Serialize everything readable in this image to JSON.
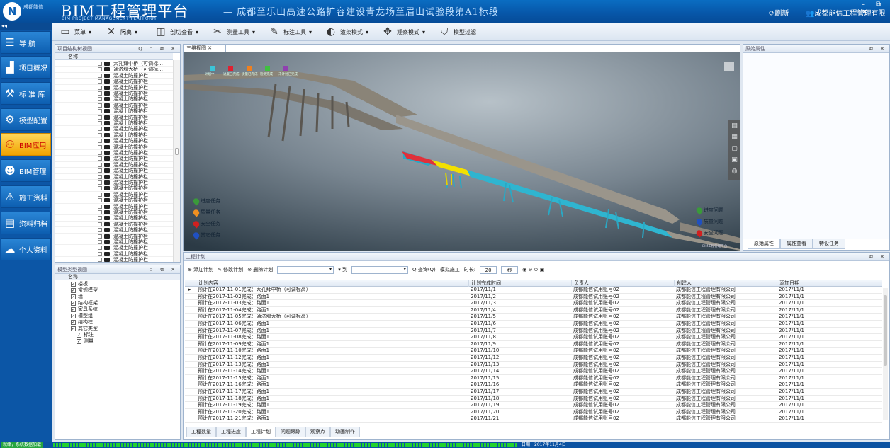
{
  "brand": "成都能信",
  "app": {
    "name": "BIM工程管理平台",
    "subtitle": "BIM PROJECT MANAGEMENT PLATFORM"
  },
  "project_title": "— 成都至乐山高速公路扩容建设青龙场至眉山试验段第A1标段",
  "header": {
    "refresh": "刷新",
    "company": "成都能信工程管理有限",
    "window_controls": "– ⧉ ✕"
  },
  "nav": {
    "collapse": "◂◂",
    "items": [
      {
        "label": "导 航",
        "icon": "list-icon"
      },
      {
        "label": "项目概况",
        "icon": "chart-icon"
      },
      {
        "label": "标 准 库",
        "icon": "tools-icon"
      },
      {
        "label": "模型配置",
        "icon": "gears-icon"
      },
      {
        "label": "BIM应用",
        "icon": "people-icon"
      },
      {
        "label": "BIM管理",
        "icon": "person-icon"
      },
      {
        "label": "施工资料",
        "icon": "warning-icon"
      },
      {
        "label": "资料归档",
        "icon": "archive-icon"
      },
      {
        "label": "个人资料",
        "icon": "cloud-user-icon"
      }
    ]
  },
  "toolbar": [
    {
      "label": "菜单",
      "icon": "▭",
      "arrow": "▾"
    },
    {
      "label": "隔离",
      "icon": "✕",
      "arrow": "▾"
    },
    {
      "label": "剖切查看",
      "icon": "◫",
      "arrow": "▾"
    },
    {
      "label": "测量工具",
      "icon": "✂",
      "arrow": "▾"
    },
    {
      "label": "标注工具",
      "icon": "✎",
      "arrow": "▾"
    },
    {
      "label": "渲染模式",
      "icon": "◐",
      "arrow": "▾"
    },
    {
      "label": "观察模式",
      "icon": "✥",
      "arrow": "▾"
    },
    {
      "label": "模型过滤",
      "icon": "⛉",
      "arrow": ""
    }
  ],
  "tree1": {
    "title": "项目结构树视图",
    "controls": "Q ▫ ⧉ ✕",
    "column": "名称",
    "rows": [
      "大孔拜中桥（可调标…",
      "通济堰大桥（可调标…",
      "混凝土防撞护栏",
      "混凝土防撞护栏",
      "混凝土防撞护栏",
      "混凝土防撞护栏",
      "混凝土防撞护栏",
      "混凝土防撞护栏",
      "混凝土防撞护栏",
      "混凝土防撞护栏",
      "混凝土防撞护栏",
      "混凝土防撞护栏",
      "混凝土防撞护栏",
      "混凝土防撞护栏",
      "混凝土防撞护栏",
      "混凝土防撞护栏",
      "混凝土防撞护栏",
      "混凝土防撞护栏",
      "混凝土防撞护栏",
      "混凝土防撞护栏",
      "混凝土防撞护栏",
      "混凝土防撞护栏",
      "混凝土防撞护栏",
      "混凝土防撞护栏",
      "混凝土防撞护栏",
      "混凝土防撞护栏",
      "混凝土防撞护栏",
      "混凝土防撞护栏",
      "混凝土防撞护栏",
      "混凝土防撞护栏",
      "混凝土防撞护栏",
      "混凝土防撞护栏",
      "混凝土防撞护栏",
      "混凝土防撞护栏"
    ]
  },
  "tree2": {
    "title": "模型类型视图",
    "controls": "▫ ⧉ ✕",
    "column": "名称",
    "rows": [
      {
        "label": "楼板",
        "indent": 0,
        "checked": true
      },
      {
        "label": "常规模型",
        "indent": 0,
        "checked": true
      },
      {
        "label": "墙",
        "indent": 0,
        "checked": true
      },
      {
        "label": "结构框架",
        "indent": 0,
        "checked": true
      },
      {
        "label": "家具系统",
        "indent": 0,
        "checked": true
      },
      {
        "label": "模型组",
        "indent": 0,
        "checked": true
      },
      {
        "label": "结构柱",
        "indent": 0,
        "checked": true
      },
      {
        "label": "其它类型",
        "indent": 0,
        "checked": true
      },
      {
        "label": "标注",
        "indent": 1,
        "checked": true
      },
      {
        "label": "测量",
        "indent": 1,
        "checked": true
      }
    ]
  },
  "view3d": {
    "tab": "三维视图 ✕",
    "legend_top": [
      {
        "label": "计划中",
        "color": "#3cc4d8"
      },
      {
        "label": "进度已完成",
        "color": "#e02030"
      },
      {
        "label": "质量已完成",
        "color": "#f08020"
      },
      {
        "label": "检测完成",
        "color": "#40c040"
      },
      {
        "label": "未计划已完成",
        "color": "#9040b0"
      }
    ],
    "tasks_left": [
      {
        "label": "进度任务",
        "color": "#3a9a3a"
      },
      {
        "label": "质量任务",
        "color": "#f09020"
      },
      {
        "label": "安全任务",
        "color": "#d02020"
      },
      {
        "label": "其它任务",
        "color": "#2050c0"
      }
    ],
    "issues_right": [
      {
        "label": "进度问题",
        "color": "#3a9a3a"
      },
      {
        "label": "质量问题",
        "color": "#2050c0"
      },
      {
        "label": "安全问题",
        "color": "#d02020"
      }
    ],
    "watermark": "BIM工程管理平台"
  },
  "props": {
    "title": "原始属性",
    "controls": "⧉ ✕",
    "tabs": [
      "原始属性",
      "属性查看",
      "特设任务"
    ]
  },
  "plan": {
    "title": "工程计划",
    "controls": "⧉ ✕",
    "toolbar": {
      "add": "⊕ 添加计划",
      "edit": "✎ 修改计划",
      "delete": "⊗ 删除计划",
      "to": "▾ 到",
      "query": "Q 查询(Q)",
      "simulate": "模拟施工",
      "duration_label": "时长:",
      "duration_value": "20",
      "unit": "秒",
      "play_icons": "◉ ⊖ ⊙ ▣"
    },
    "columns": [
      "计划内容",
      "计划完成时间",
      "负责人",
      "创建人",
      "添加日期"
    ],
    "rows": [
      [
        "预计在2017-11-01完成：大孔拜中桥（可调标高）",
        "2017/11/1",
        "成都能信试用账号02",
        "成都能信工程管理有限公司",
        "2017/11/1"
      ],
      [
        "预计在2017-11-02完成：路面1",
        "2017/11/2",
        "成都能信试用账号02",
        "成都能信工程管理有限公司",
        "2017/11/1"
      ],
      [
        "预计在2017-11-03完成：路面1",
        "2017/11/3",
        "成都能信试用账号02",
        "成都能信工程管理有限公司",
        "2017/11/1"
      ],
      [
        "预计在2017-11-04完成：路面1",
        "2017/11/4",
        "成都能信试用账号02",
        "成都能信工程管理有限公司",
        "2017/11/1"
      ],
      [
        "预计在2017-11-05完成：通济堰大桥（可调标高）",
        "2017/11/5",
        "成都能信试用账号02",
        "成都能信工程管理有限公司",
        "2017/11/1"
      ],
      [
        "预计在2017-11-06完成：路面1",
        "2017/11/6",
        "成都能信试用账号02",
        "成都能信工程管理有限公司",
        "2017/11/1"
      ],
      [
        "预计在2017-11-07完成：路面1",
        "2017/11/7",
        "成都能信试用账号02",
        "成都能信工程管理有限公司",
        "2017/11/1"
      ],
      [
        "预计在2017-11-08完成：路面1",
        "2017/11/8",
        "成都能信试用账号02",
        "成都能信工程管理有限公司",
        "2017/11/1"
      ],
      [
        "预计在2017-11-09完成：路面1",
        "2017/11/9",
        "成都能信试用账号02",
        "成都能信工程管理有限公司",
        "2017/11/1"
      ],
      [
        "预计在2017-11-10完成：路面1",
        "2017/11/10",
        "成都能信试用账号02",
        "成都能信工程管理有限公司",
        "2017/11/1"
      ],
      [
        "预计在2017-11-12完成：路面1",
        "2017/11/12",
        "成都能信试用账号02",
        "成都能信工程管理有限公司",
        "2017/11/1"
      ],
      [
        "预计在2017-11-13完成：路面1",
        "2017/11/13",
        "成都能信试用账号02",
        "成都能信工程管理有限公司",
        "2017/11/1"
      ],
      [
        "预计在2017-11-14完成：路面1",
        "2017/11/14",
        "成都能信试用账号02",
        "成都能信工程管理有限公司",
        "2017/11/1"
      ],
      [
        "预计在2017-11-15完成：路面1",
        "2017/11/15",
        "成都能信试用账号02",
        "成都能信工程管理有限公司",
        "2017/11/1"
      ],
      [
        "预计在2017-11-16完成：路面1",
        "2017/11/16",
        "成都能信试用账号02",
        "成都能信工程管理有限公司",
        "2017/11/1"
      ],
      [
        "预计在2017-11-17完成：路面1",
        "2017/11/17",
        "成都能信试用账号02",
        "成都能信工程管理有限公司",
        "2017/11/1"
      ],
      [
        "预计在2017-11-18完成：路面1",
        "2017/11/18",
        "成都能信试用账号02",
        "成都能信工程管理有限公司",
        "2017/11/1"
      ],
      [
        "预计在2017-11-19完成：路面1",
        "2017/11/19",
        "成都能信试用账号02",
        "成都能信工程管理有限公司",
        "2017/11/1"
      ],
      [
        "预计在2017-11-20完成：路面1",
        "2017/11/20",
        "成都能信试用账号02",
        "成都能信工程管理有限公司",
        "2017/11/1"
      ],
      [
        "预计在2017-11-21完成：路面1",
        "2017/11/21",
        "成都能信试用账号02",
        "成都能信工程管理有限公司",
        "2017/11/1"
      ]
    ],
    "tabs": [
      "工程数量",
      "工程进度",
      "工程计划",
      "问题跟踪",
      "观察点",
      "动画制作"
    ],
    "active_tab": 2
  },
  "status": {
    "left": "就绪，系统数据加载",
    "date": "日期：2017年11月4日"
  }
}
